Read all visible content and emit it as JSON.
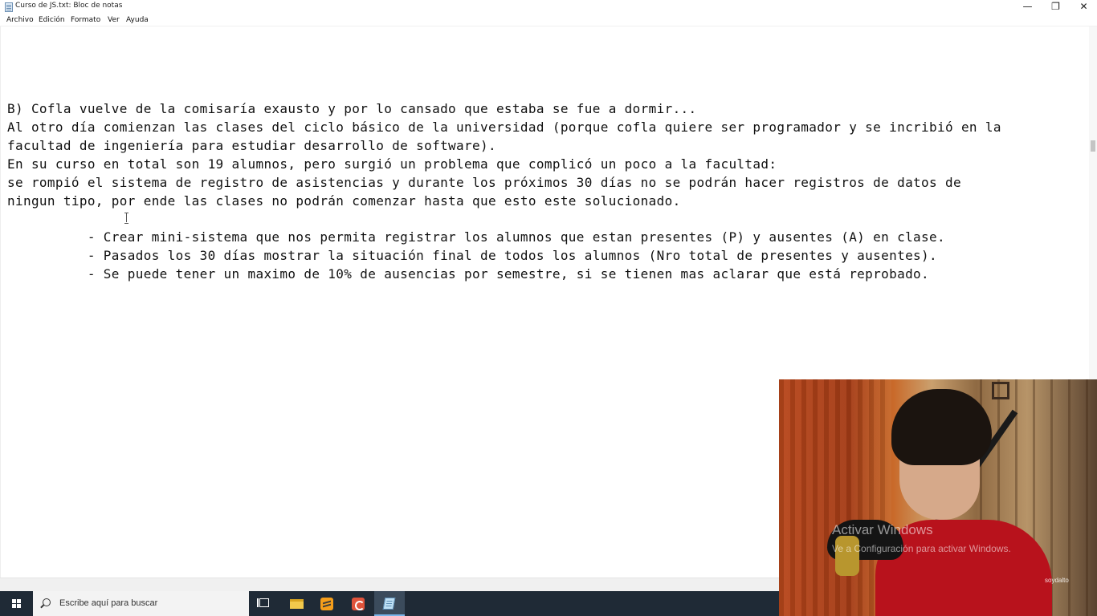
{
  "window": {
    "title": "Curso de JS.txt: Bloc de notas",
    "minimize_glyph": "—",
    "maximize_glyph": "❐",
    "close_glyph": "✕"
  },
  "menu": {
    "items": [
      "Archivo",
      "Edición",
      "Formato",
      "Ver",
      "Ayuda"
    ]
  },
  "document": {
    "lines": [
      "B) Cofla vuelve de la comisaría exausto y por lo cansado que estaba se fue a dormir...",
      "Al otro día comienzan las clases del ciclo básico de la universidad (porque cofla quiere ser programador y se incribió en la",
      "facultad de ingeniería para estudiar desarrollo de software).",
      "En su curso en total son 19 alumnos, pero surgió un problema que complicó un poco a la facultad:",
      "se rompió el sistema de registro de asistencias y durante los próximos 30 días no se podrán hacer registros de datos de",
      "ningun tipo, por ende las clases no podrán comenzar hasta que esto este solucionado.",
      "",
      "          - Crear mini-sistema que nos permita registrar los alumnos que estan presentes (P) y ausentes (A) en clase.",
      "          - Pasados los 30 días mostrar la situación final de todos los alumnos (Nro total de presentes y ausentes).",
      "          - Se puede tener un maximo de 10% de ausencias por semestre, si se tienen mas aclarar que está reprobado."
    ]
  },
  "taskbar": {
    "search_placeholder": "Escribe aquí para buscar",
    "apps": [
      "windows-start-icon",
      "task-view-icon",
      "file-explorer-icon",
      "sublime-text-icon",
      "code-app-icon",
      "notepad-icon"
    ]
  },
  "overlay": {
    "watermark_title": "Activar Windows",
    "watermark_subtitle": "Ve a Configuración para activar Windows.",
    "credit": "soydalto"
  }
}
